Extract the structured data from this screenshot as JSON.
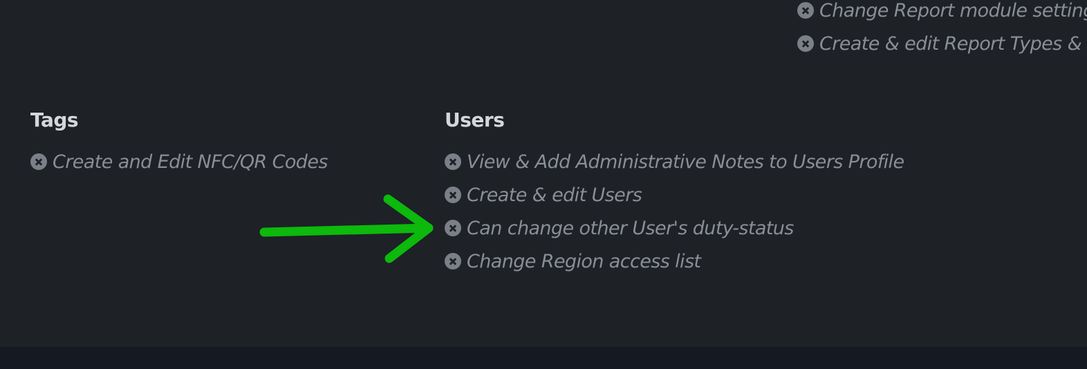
{
  "reports": {
    "items": [
      {
        "label": "Change Report module settings",
        "icon": "x-circle-icon"
      },
      {
        "label": "Create & edit Report Types & Levels",
        "icon": "x-circle-icon"
      }
    ]
  },
  "tags": {
    "title": "Tags",
    "items": [
      {
        "label": "Create and Edit NFC/QR Codes",
        "icon": "x-circle-icon"
      }
    ]
  },
  "users": {
    "title": "Users",
    "items": [
      {
        "label": "View & Add Administrative Notes to Users Profile",
        "icon": "x-circle-icon"
      },
      {
        "label": "Create & edit Users",
        "icon": "x-circle-icon"
      },
      {
        "label": "Can change other User's duty-status",
        "icon": "x-circle-icon"
      },
      {
        "label": "Change Region access list",
        "icon": "x-circle-icon"
      }
    ]
  },
  "annotation": {
    "type": "arrow",
    "color": "#0cb90c",
    "points_to": "Can change other User's duty-status"
  }
}
